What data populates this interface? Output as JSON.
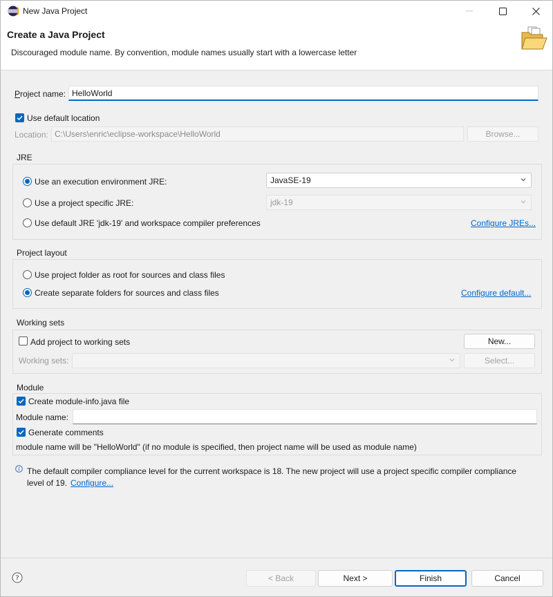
{
  "window": {
    "title": "New Java Project"
  },
  "banner": {
    "title": "Create a Java Project",
    "message": "Discouraged module name. By convention, module names usually start with a lowercase letter"
  },
  "project": {
    "name_label": "Project name:",
    "name_value": "HelloWorld",
    "use_default_location_label": "Use default location",
    "use_default_location_checked": true,
    "location_label": "Location:",
    "location_value": "C:\\Users\\enric\\eclipse-workspace\\HelloWorld",
    "browse_label": "Browse..."
  },
  "jre": {
    "title": "JRE",
    "option_exec_env": "Use an execution environment JRE:",
    "exec_env_value": "JavaSE-19",
    "option_project_specific": "Use a project specific JRE:",
    "project_specific_value": "jdk-19",
    "option_default": "Use default JRE 'jdk-19' and workspace compiler preferences",
    "configure_link": "Configure JREs...",
    "selected": "exec_env"
  },
  "layout": {
    "title": "Project layout",
    "option_root": "Use project folder as root for sources and class files",
    "option_separate": "Create separate folders for sources and class files",
    "configure_link": "Configure default...",
    "selected": "separate"
  },
  "working_sets": {
    "title": "Working sets",
    "add_label": "Add project to working sets",
    "add_checked": false,
    "new_label": "New...",
    "sets_label": "Working sets:",
    "select_label": "Select..."
  },
  "module": {
    "title": "Module",
    "create_label": "Create module-info.java file",
    "create_checked": true,
    "name_label": "Module name:",
    "name_value": "",
    "generate_comments_label": "Generate comments",
    "generate_comments_checked": true,
    "info_text": "module name will be \"HelloWorld\"  (if no module is specified, then project name will be used as module name)"
  },
  "compliance": {
    "text": "The default compiler compliance level for the current workspace is 18. The new project will use a project specific compiler compliance",
    "text2": "level of 19.",
    "configure_link": "Configure..."
  },
  "footer": {
    "back_label": "< Back",
    "next_label": "Next >",
    "finish_label": "Finish",
    "cancel_label": "Cancel"
  },
  "colors": {
    "accent": "#0067c0",
    "link": "#0066cc"
  },
  "icons": [
    "eclipse-icon",
    "minimize-icon",
    "maximize-icon",
    "close-icon",
    "folder-icon",
    "chevron-down-icon",
    "info-icon",
    "help-icon",
    "checkmark-icon"
  ]
}
